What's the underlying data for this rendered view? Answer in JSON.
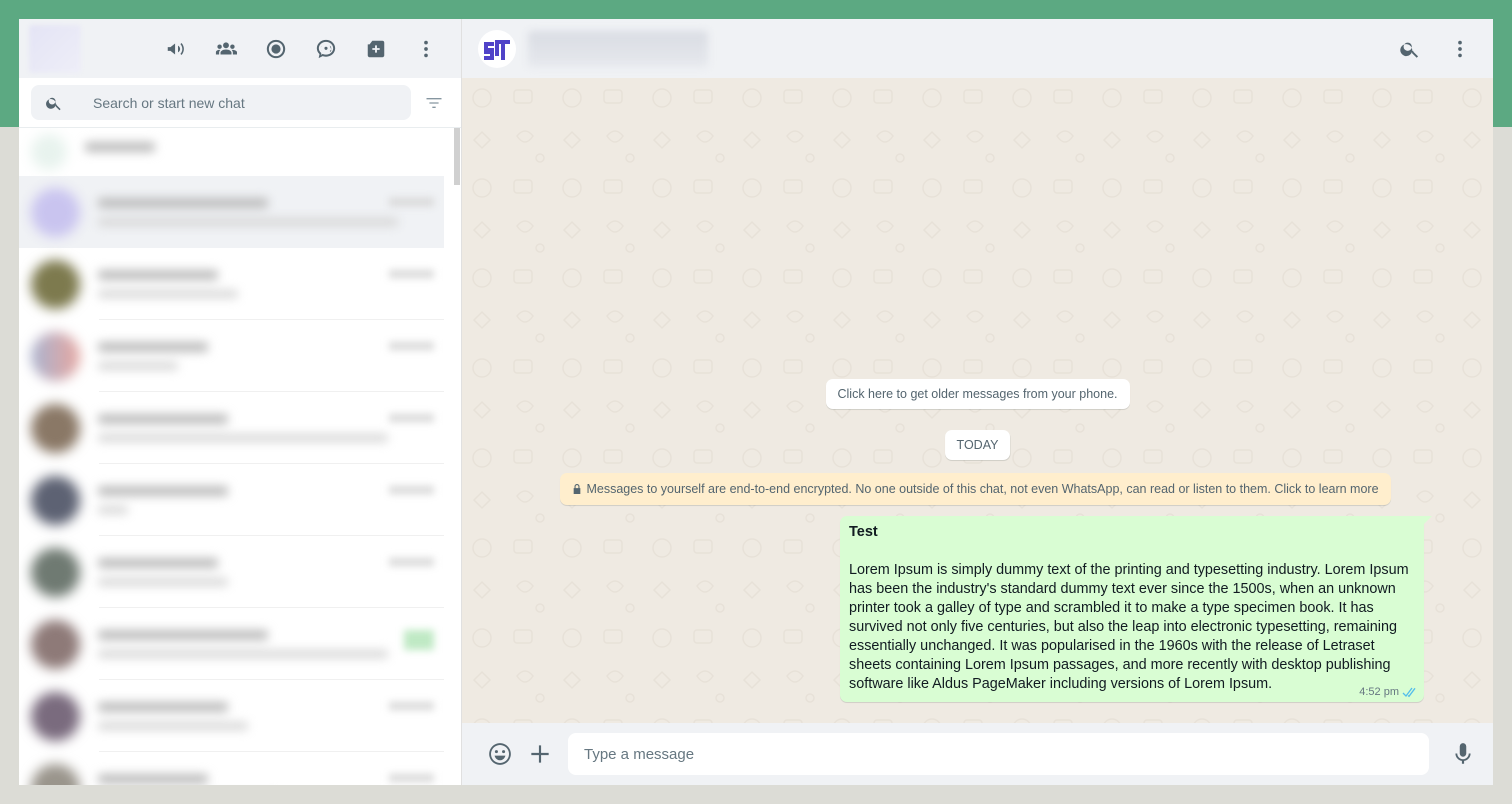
{
  "colors": {
    "brand_band": "#5ca982",
    "panel_bg": "#f0f2f5",
    "conversation_bg": "#efeae2",
    "outgoing_bubble": "#d9fdd3",
    "encryption_notice_bg": "#ffeecd",
    "icon": "#54656f",
    "read_ticks": "#53bdeb",
    "contact_logo": "#5043c8"
  },
  "sidebar": {
    "header_icons": [
      "megaphone-icon",
      "communities-icon",
      "status-icon",
      "channels-icon",
      "new-chat-icon",
      "menu-icon"
    ],
    "search": {
      "placeholder": "Search or start new chat",
      "value": ""
    },
    "filter_icon": "filter-icon"
  },
  "chat": {
    "header_icons": [
      "search-icon",
      "menu-icon"
    ],
    "older_messages": "Click here to get older messages from your phone.",
    "date_divider": "TODAY",
    "encryption_notice": "Messages to yourself are end-to-end encrypted. No one outside of this chat, not even WhatsApp, can read or listen to them. Click to learn more",
    "message": {
      "title": "Test",
      "body": "Lorem Ipsum is simply dummy text of the printing and typesetting industry. Lorem Ipsum has been the industry's standard dummy text ever since the 1500s, when an unknown printer took a galley of type and scrambled it to make a type specimen book. It has survived not only five centuries, but also the leap into electronic typesetting, remaining essentially unchanged. It was popularised in the 1960s with the release of Letraset sheets containing Lorem Ipsum passages, and more recently with desktop publishing software like Aldus PageMaker including versions of Lorem Ipsum.",
      "time": "4:52 pm",
      "status": "read"
    },
    "composer": {
      "placeholder": "Type a message",
      "value": ""
    }
  }
}
